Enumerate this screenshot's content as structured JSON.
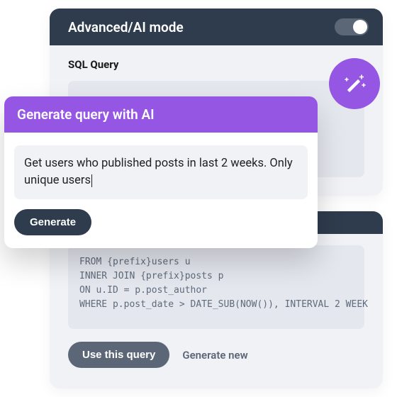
{
  "header": {
    "title": "Advanced/AI mode",
    "toggle_on": true
  },
  "query_panel": {
    "label": "SQL Query"
  },
  "magic_button": {
    "icon": "magic-wand-icon"
  },
  "ai_popup": {
    "title": "Generate query with AI",
    "prompt": "Get users who published posts in last 2 weeks. Only unique users",
    "generate_label": "Generate"
  },
  "result_panel": {
    "code": "FROM {prefix}users u\nINNER JOIN {prefix}posts p\nON u.ID = p.post_author\nWHERE p.post_date > DATE_SUB(NOW()), INTERVAL 2 WEEK",
    "use_label": "Use this query",
    "generate_new_label": "Generate new"
  },
  "colors": {
    "accent_purple": "#9556e3",
    "dark_slate": "#2f3c4d",
    "panel_bg": "#f0f2f6",
    "inset_bg": "#e4e7ee",
    "muted_btn": "#5b6676"
  }
}
